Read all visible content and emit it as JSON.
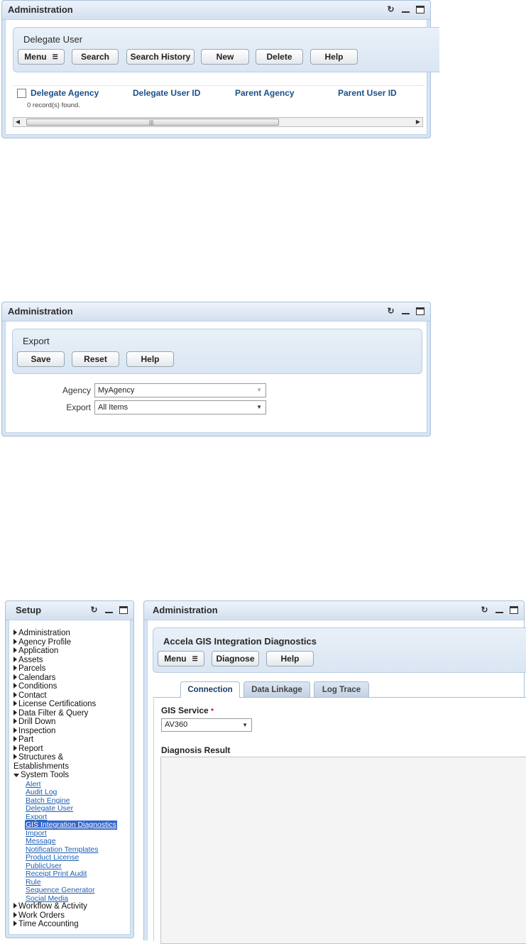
{
  "panel1": {
    "title": "Administration",
    "box_title": "Delegate User",
    "buttons": {
      "menu": "Menu",
      "search": "Search",
      "search_history": "Search History",
      "new": "New",
      "delete": "Delete",
      "help": "Help"
    },
    "columns": [
      "Delegate Agency",
      "Delegate User ID",
      "Parent Agency",
      "Parent User ID"
    ],
    "records_text": "0 record(s) found."
  },
  "panel2": {
    "title": "Administration",
    "box_title": "Export",
    "buttons": {
      "save": "Save",
      "reset": "Reset",
      "help": "Help"
    },
    "agency_label": "Agency",
    "agency_value": "MyAgency",
    "export_label": "Export",
    "export_value": "All Items"
  },
  "setup": {
    "title": "Setup",
    "tree": [
      "Administration",
      "Agency Profile",
      "Application",
      "Assets",
      "Parcels",
      "Calendars",
      "Conditions",
      "Contact",
      "License Certifications",
      "Data Filter & Query",
      "Drill Down",
      "Inspection",
      "Part",
      "Report",
      "Structures &",
      "Establishments",
      "System Tools"
    ],
    "system_tools_children": [
      "Alert",
      "Audit Log",
      "Batch Engine",
      "Delegate User",
      "Export",
      "GIS Integration Diagnostics",
      "Import",
      "Message",
      "Notification Templates",
      "Product License",
      "PublicUser",
      "Receipt Print Audit",
      "Rule",
      "Sequence Generator",
      "Social Media"
    ],
    "selected_child": "GIS Integration Diagnostics",
    "tree_after": [
      "Workflow & Activity",
      "Work Orders",
      "Time Accounting"
    ]
  },
  "panel3": {
    "title": "Administration",
    "box_title": "Accela GIS Integration Diagnostics",
    "buttons": {
      "menu": "Menu",
      "diagnose": "Diagnose",
      "help": "Help"
    },
    "tabs": [
      "Connection",
      "Data Linkage",
      "Log Trace"
    ],
    "active_tab": "Connection",
    "gis_service_label": "GIS Service",
    "required_mark": "*",
    "gis_service_value": "AV360",
    "diagnosis_label": "Diagnosis Result"
  },
  "icons": {
    "refresh": "refresh-icon",
    "minimize": "minimize-icon",
    "maximize": "maximize-icon",
    "expand": "triangle-right-icon",
    "collapse": "triangle-down-icon"
  },
  "colors": {
    "header_bg": "#d3e0ef",
    "link": "#1f5fb4",
    "selected": "#3366cc",
    "column_header": "#1a4f8a",
    "required": "#cc0000"
  }
}
